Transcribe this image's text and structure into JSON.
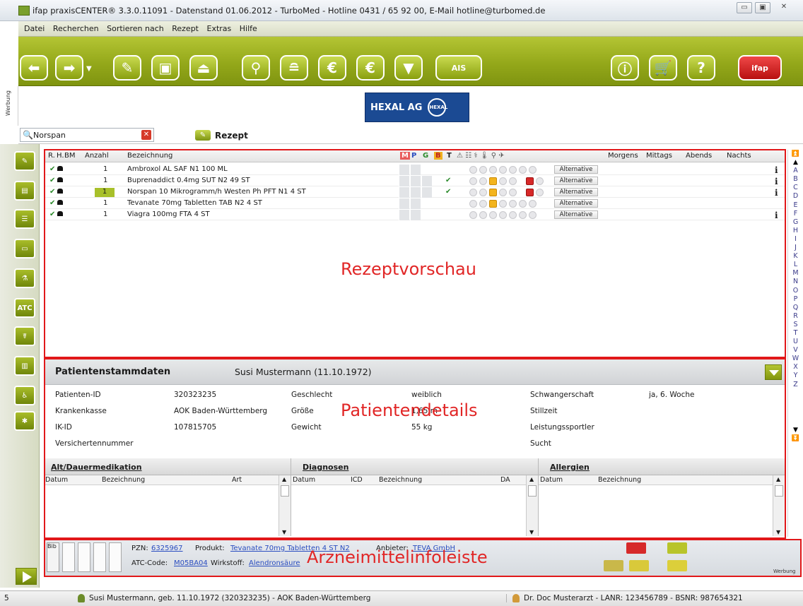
{
  "window": {
    "title": "ifap praxisCENTER® 3.3.0.11091 - Datenstand 01.06.2012 - TurboMed - Hotline 0431 / 65 92 00, E-Mail hotline@turbomed.de",
    "minimize_glyph": "▭",
    "maximize_glyph": "▣",
    "close_glyph": "✕"
  },
  "menu": {
    "items": [
      "Datei",
      "Recherchen",
      "Sortieren nach",
      "Rezept",
      "Extras",
      "Hilfe"
    ]
  },
  "toolbar": {
    "ais_label": "AIS",
    "ifap_label": "ifap"
  },
  "ad": {
    "side_label": "Werbung",
    "brand": "HEXAL AG",
    "logo_text": "HEXAL"
  },
  "search": {
    "value": "Norspan",
    "icon_glyph": "🔍",
    "clear_glyph": "✕",
    "rezept_label": "Rezept"
  },
  "sidebar": {
    "atc_label": "ATC"
  },
  "grid": {
    "headers": [
      "R.",
      "H.",
      "BM",
      "Anzahl",
      "Bezeichnung",
      "M",
      "P",
      "G",
      "B",
      "T",
      "Morgens",
      "Mittags",
      "Abends",
      "Nachts"
    ],
    "rows": [
      {
        "anzahl": "1",
        "bezeichnung": "Ambroxol AL SAF N1 100 ML",
        "alt": "Alternative",
        "check": "",
        "info": "i"
      },
      {
        "anzahl": "1",
        "bezeichnung": "Buprenaddict 0.4mg SUT N2 49 ST",
        "alt": "Alternative",
        "check": "✔",
        "info": "i"
      },
      {
        "anzahl": "1",
        "bezeichnung": "Norspan 10 Mikrogramm/h Westen Ph PFT N1 4 ST",
        "alt": "Alternative",
        "check": "✔",
        "info": "i"
      },
      {
        "anzahl": "1",
        "bezeichnung": "Tevanate 70mg Tabletten TAB N2 4 ST",
        "alt": "Alternative",
        "check": "",
        "info": ""
      },
      {
        "anzahl": "1",
        "bezeichnung": "Viagra 100mg FTA 4 ST",
        "alt": "Alternative",
        "check": "",
        "info": "i"
      }
    ],
    "overlay_label": "Rezeptvorschau"
  },
  "patient": {
    "section_title": "Patientenstammdaten",
    "name": "Susi Mustermann (11.10.1972)",
    "fields_left": [
      {
        "label": "Patienten-ID",
        "value": "320323235"
      },
      {
        "label": "Krankenkasse",
        "value": "AOK Baden-Württemberg"
      },
      {
        "label": "IK-ID",
        "value": "107815705"
      },
      {
        "label": "Versichertennummer",
        "value": ""
      }
    ],
    "fields_mid": [
      {
        "label": "Geschlecht",
        "value": "weiblich"
      },
      {
        "label": "Größe",
        "value": "1,65 m"
      },
      {
        "label": "Gewicht",
        "value": "55 kg"
      }
    ],
    "fields_right": [
      {
        "label": "Schwangerschaft",
        "value": "ja, 6. Woche"
      },
      {
        "label": "Stillzeit",
        "value": ""
      },
      {
        "label": "Leistungssportler",
        "value": ""
      },
      {
        "label": "Sucht",
        "value": ""
      }
    ],
    "overlay_label": "Patientendetails"
  },
  "subpanels": {
    "dauer": {
      "title": "Alt/Dauermedikation",
      "cols": [
        "Datum",
        "Bezeichnung",
        "Art"
      ]
    },
    "diagnosen": {
      "title": "Diagnosen",
      "cols": [
        "Datum",
        "ICD",
        "Bezeichnung",
        "DA"
      ]
    },
    "allergien": {
      "title": "Allergien",
      "cols": [
        "Datum",
        "Bezeichnung"
      ]
    }
  },
  "infobar": {
    "bib": "Bib",
    "pzn_label": "PZN:",
    "pzn": "6325967",
    "produkt_label": "Produkt:",
    "produkt": "Tevanate 70mg Tabletten 4 ST N2",
    "anbieter_label": "Anbieter:",
    "anbieter": "TEVA GmbH",
    "atc_label": "ATC-Code:",
    "atc": "M05BA04",
    "wirkstoff_label": "Wirkstoff:",
    "wirkstoff": "Alendronsäure",
    "overlay_label": "Arzneimittelinfoleiste",
    "werbung": "Werbung"
  },
  "status": {
    "count": "5",
    "patient": "Susi Mustermann, geb. 11.10.1972 (320323235) - AOK Baden-Württemberg",
    "doctor": "Dr. Doc Musterarzt - LANR: 123456789 - BSNR: 987654321"
  },
  "alphabet": [
    "A",
    "B",
    "C",
    "D",
    "E",
    "F",
    "G",
    "H",
    "I",
    "J",
    "K",
    "L",
    "M",
    "N",
    "O",
    "P",
    "Q",
    "R",
    "S",
    "T",
    "U",
    "V",
    "W",
    "X",
    "Y",
    "Z"
  ],
  "colors": {
    "accent_green": "#94a81a",
    "highlight_red": "#e1181a",
    "brand_blue": "#1b4a93",
    "link_blue": "#2a4dc0"
  }
}
